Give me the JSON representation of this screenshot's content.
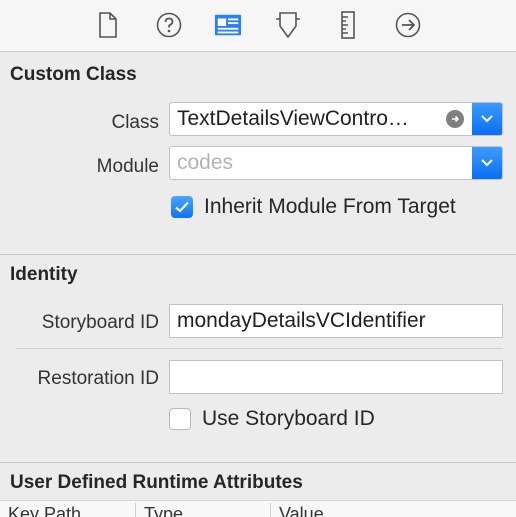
{
  "toolbar": {
    "icons": [
      "file-icon",
      "help-icon",
      "identity-icon",
      "attributes-icon",
      "size-icon",
      "connections-icon"
    ],
    "selected": "identity-icon",
    "accent": "#2b7ff2"
  },
  "custom_class": {
    "title": "Custom Class",
    "class_label": "Class",
    "class_value": "TextDetailsViewContro…",
    "module_label": "Module",
    "module_placeholder": "codes",
    "inherit_label": "Inherit Module From Target",
    "inherit_checked": true
  },
  "identity": {
    "title": "Identity",
    "storyboard_id_label": "Storyboard ID",
    "storyboard_id_value": "mondayDetailsVCIdentifier",
    "restoration_id_label": "Restoration ID",
    "restoration_id_value": "",
    "use_storyboard_label": "Use Storyboard ID",
    "use_storyboard_checked": false
  },
  "runtime_attributes": {
    "title": "User Defined Runtime Attributes",
    "columns": [
      "Key Path",
      "Type",
      "Value"
    ]
  }
}
